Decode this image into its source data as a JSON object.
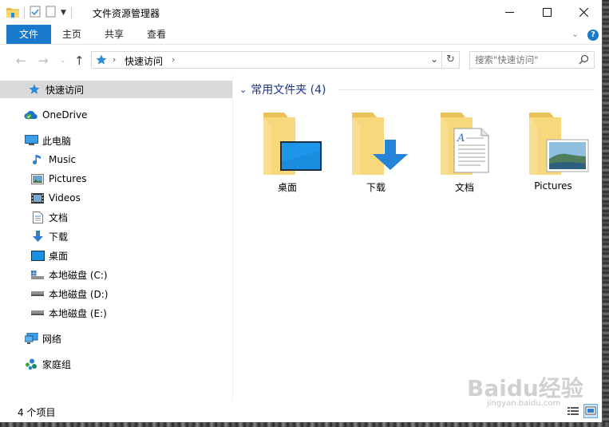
{
  "window": {
    "title": "文件资源管理器"
  },
  "ribbon": {
    "tabs": [
      "文件",
      "主页",
      "共享",
      "查看"
    ]
  },
  "address": {
    "crumb": "快速访问",
    "search_placeholder": "搜索\"快速访问\""
  },
  "nav": {
    "quick_access": "快速访问",
    "onedrive": "OneDrive",
    "this_pc": "此电脑",
    "music": "Music",
    "pictures": "Pictures",
    "videos": "Videos",
    "documents": "文档",
    "downloads": "下载",
    "desktop": "桌面",
    "drive_c": "本地磁盘 (C:)",
    "drive_d": "本地磁盘 (D:)",
    "drive_e": "本地磁盘 (E:)",
    "network": "网络",
    "homegroup": "家庭组"
  },
  "content": {
    "group_title": "常用文件夹 (4)",
    "folders": [
      "桌面",
      "下载",
      "文档",
      "Pictures"
    ]
  },
  "status": {
    "item_count": "4 个项目"
  },
  "watermark": {
    "brand": "Baidu经验",
    "url": "jingyan.baidu.com"
  },
  "colors": {
    "accent": "#1979ca",
    "folder": "#f5d77c",
    "group_header": "#1e3287",
    "selected": "#d9d9d9"
  }
}
